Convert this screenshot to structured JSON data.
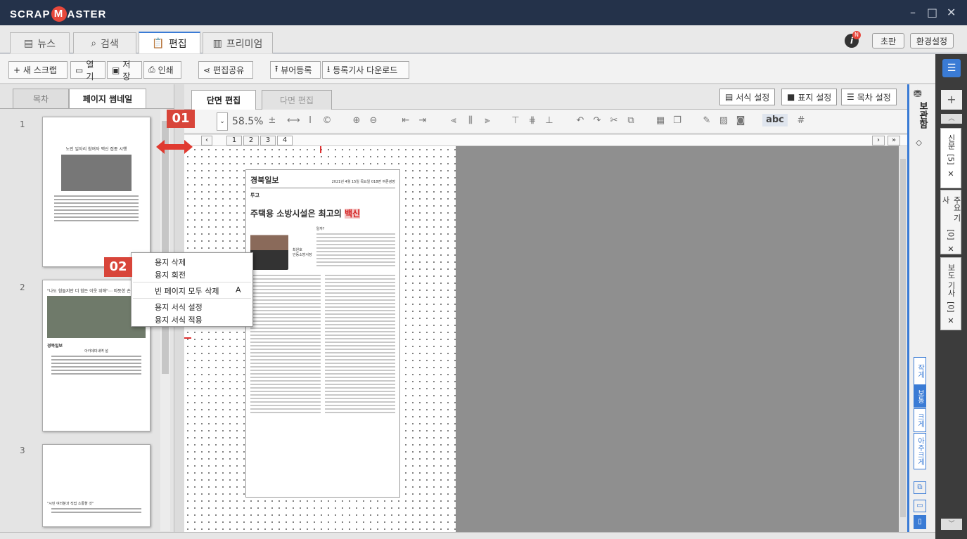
{
  "app": {
    "logo_left": "SCRAP",
    "logo_m": "M",
    "logo_right": "ASTER"
  },
  "window_controls": {
    "minimize": "–",
    "maximize": "□",
    "close": "✕"
  },
  "main_tabs": [
    {
      "label": "뉴스",
      "icon": "news-icon"
    },
    {
      "label": "검색",
      "icon": "search-icon"
    },
    {
      "label": "편집",
      "icon": "clipboard-icon",
      "active": true
    },
    {
      "label": "프리미엄",
      "icon": "premium-icon"
    }
  ],
  "top_right": {
    "notification_letter": "N",
    "edition_button": "초판",
    "settings_button": "환경설정"
  },
  "toolbar": {
    "new_scrap": "+ 새 스크랩",
    "open": "열기",
    "save": "저장",
    "print": "인쇄",
    "share": "편집공유",
    "viewer_register": "뷰어등록",
    "download_registered": "등록기사 다운로드"
  },
  "left_panel": {
    "tabs": [
      "목차",
      "페이지 썸네일"
    ],
    "page_numbers": [
      "1",
      "2",
      "3"
    ],
    "thumb1_title": "노인 일자리 참여자 백신 접종 시행",
    "thumb2_title": "\"나도 힘들지만 더 힘든 이웃 위해\"⋯ 따뜻한 손길",
    "thumb2_section": "경북일보",
    "thumb2_subtitle": "아카데미내역 설",
    "thumb3_title": "\"시민 여러분과 직접 소통할 것\""
  },
  "editor": {
    "tabs": [
      "단면 편집",
      "다면 편집"
    ],
    "right_buttons": [
      "서식 설정",
      "표지 설정",
      "목차 설정"
    ],
    "zoom": "58.5%",
    "page_tabs": [
      "1",
      "2",
      "3",
      "4"
    ],
    "text_style": "abc"
  },
  "article": {
    "paper": "경북일보",
    "date": "2021년 4월 15일 목요일 018면 여론광장",
    "section": "투고",
    "headline_main": "주택용 소방시설은 최고의 ",
    "headline_highlight": "백신",
    "byline_name": "최원호",
    "byline_role": "안동소방서장",
    "lead": "일까?",
    "highlight_color": "#e8453a"
  },
  "context_menu": {
    "items": [
      "용지 삭제",
      "용지 회전",
      "빈 페이지 모두 삭제",
      "용지 서식 설정",
      "용지 서식 적용"
    ],
    "shortcut": "A"
  },
  "annotations": {
    "badge1": "01",
    "badge2": "02"
  },
  "right_strip": {
    "storage_label": "보관함",
    "size_buttons": [
      "작게",
      "보통",
      "크게",
      "아주크게"
    ]
  },
  "far_right": {
    "tabs": [
      {
        "label": "신문",
        "count": "[5]"
      },
      {
        "label": "주요 기사",
        "count": "[0]"
      },
      {
        "label": "보도 기사",
        "count": "[0]"
      }
    ]
  },
  "colors": {
    "title_bar": "#24324a",
    "accent": "#3a7bd5",
    "badge": "#d8453a"
  }
}
